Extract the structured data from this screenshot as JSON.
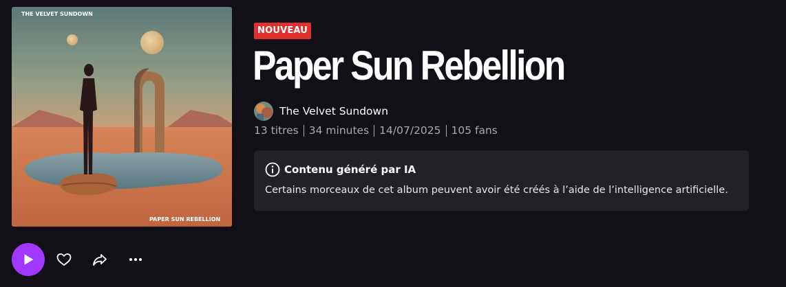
{
  "cover": {
    "artist_text": "THE VELVET SUNDOWN",
    "album_text": "PAPER SUN REBELLION"
  },
  "badge": "NOUVEAU",
  "album": {
    "title": "Paper Sun Rebellion",
    "artist": "The Velvet Sundown"
  },
  "meta": {
    "tracks": "13 titres",
    "duration": "34 minutes",
    "date": "14/07/2025",
    "fans": "105 fans"
  },
  "ai_notice": {
    "icon": "info-icon",
    "title": "Contenu généré par IA",
    "body": "Certains morceaux de cet album peuvent avoir été créés à l’aide de l’intelligence artificielle."
  },
  "colors": {
    "background": "#121016",
    "accent": "#a238ff",
    "badge": "#e0302f",
    "notice_bg": "#222127"
  },
  "actions": {
    "play_icon": "play-icon",
    "favorite_icon": "heart-icon",
    "share_icon": "share-icon",
    "more_icon": "more-icon"
  }
}
